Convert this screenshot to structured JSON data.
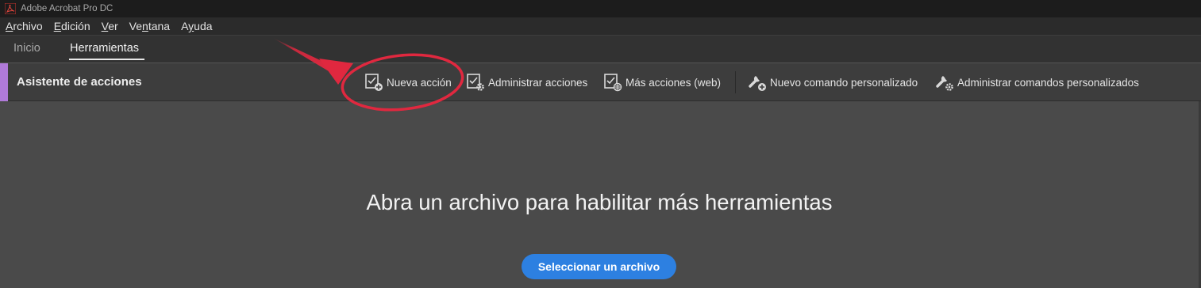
{
  "window": {
    "title": "Adobe Acrobat Pro DC"
  },
  "menubar": {
    "items": [
      {
        "underline": "A",
        "rest": "rchivo"
      },
      {
        "underline": "E",
        "rest": "dición"
      },
      {
        "underline": "V",
        "rest": "er"
      },
      {
        "underline": "",
        "rest": "Ve",
        "underline2": "n",
        "rest2": "tana"
      },
      {
        "underline": "",
        "rest": "A",
        "underline2": "y",
        "rest2": "uda"
      }
    ]
  },
  "tabs": [
    {
      "label": "Inicio",
      "active": false
    },
    {
      "label": "Herramientas",
      "active": true
    }
  ],
  "toolbar": {
    "title": "Asistente de acciones",
    "accent_color": "#b07ad9",
    "buttons": [
      {
        "label": "Nueva acción",
        "icon": "new-action-icon"
      },
      {
        "label": "Administrar acciones",
        "icon": "manage-actions-icon"
      },
      {
        "label": "Más acciones (web)",
        "icon": "more-actions-web-icon"
      },
      {
        "label": "Nuevo comando personalizado",
        "icon": "new-custom-command-icon"
      },
      {
        "label": "Administrar comandos personalizados",
        "icon": "manage-custom-commands-icon"
      }
    ]
  },
  "main": {
    "headline": "Abra un archivo para habilitar más herramientas",
    "select_button": "Seleccionar un archivo",
    "button_color": "#2d80e1"
  },
  "annotation": {
    "color": "#e0283f"
  }
}
